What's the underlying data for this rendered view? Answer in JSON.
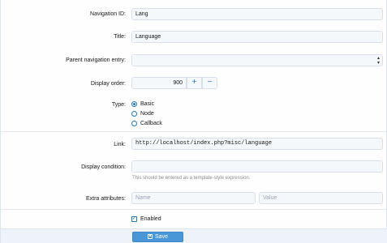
{
  "fields": {
    "navigation_id": {
      "label": "Navigation ID:",
      "value": "Lang"
    },
    "title": {
      "label": "Title:",
      "value": "Language"
    },
    "parent": {
      "label": "Parent navigation entry:",
      "value": ""
    },
    "display_order": {
      "label": "Display order:",
      "value": "900",
      "plus": "+",
      "minus": "−"
    },
    "type": {
      "label": "Type:",
      "options": [
        {
          "label": "Basic",
          "selected": true
        },
        {
          "label": "Node",
          "selected": false
        },
        {
          "label": "Callback",
          "selected": false
        }
      ]
    },
    "link": {
      "label": "Link:",
      "value": "http://localhost/index.php?misc/language"
    },
    "display_condition": {
      "label": "Display condition:",
      "value": "",
      "hint": "This should be entered as a template-style expression."
    },
    "extra_attributes": {
      "label": "Extra attributes:",
      "name_placeholder": "Name",
      "value_placeholder": "Value"
    },
    "enabled": {
      "label": "Enabled",
      "checked": true
    }
  },
  "footer": {
    "save_label": "Save"
  },
  "colors": {
    "accent": "#2577b1",
    "button": "#4a97d8",
    "input_bg": "#f5f8fb",
    "footer_bg": "#edf3f8"
  },
  "icons": {
    "save": "save-disk-icon",
    "select": "select-arrows-icon",
    "check": "checkmark-icon"
  }
}
